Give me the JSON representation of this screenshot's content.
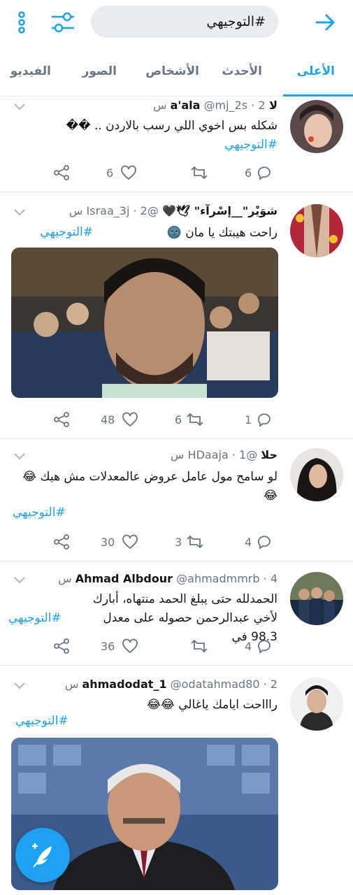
{
  "search": {
    "query": "#التوجيهي"
  },
  "tabs": [
    "الأعلى",
    "الأحدث",
    "الأشخاص",
    "الصور",
    "الفيديو"
  ],
  "tweets": [
    {
      "name": "لا a'ala",
      "handle": "@mj_2s",
      "time": "2 س",
      "text": "شكله بس اخوي اللي رسب بالاردن .. ��",
      "hashtag": "#التوجيهي",
      "replies": "6",
      "retweets": "",
      "likes": "6"
    },
    {
      "name": "شوَيْر\"__إسْرآء\" 🕊🖤",
      "handle": "@Israa_3j",
      "time": "2 س",
      "text": "راحت هيبتك يا مان 🌚",
      "hashtag": "#التوجيهي",
      "replies": "1",
      "retweets": "6",
      "likes": "48"
    },
    {
      "name": "حلا",
      "handle": "@HDaaja",
      "time": "1 س",
      "text": "لو سامح مول عامل عروض عالمعدلات مش هيك 😂😂",
      "hashtag": "#التوجيهي",
      "replies": "4",
      "retweets": "3",
      "likes": "30"
    },
    {
      "name": "Ahmad Albdour",
      "handle": "@ahmadmmrb",
      "time": "4 س",
      "text": "الحمدلله حتى يبلغ الحمد منتهاه، أبارك لأخي عبدالرحمن حصوله على معدل 98.3 في",
      "hashtag": "#التوجيهي",
      "replies": "4",
      "retweets": "",
      "likes": "36"
    },
    {
      "name": "ahmadodat_1",
      "handle": "@odatahmad80",
      "time": "2 س",
      "text": "راااحت ايامك ياغالي 😂😂",
      "hashtag": "#التوجيهي",
      "replies": "",
      "retweets": "",
      "likes": ""
    }
  ],
  "colors": {
    "accent": "#1da1f2",
    "muted": "#657786",
    "divider": "#e1e8ed"
  }
}
